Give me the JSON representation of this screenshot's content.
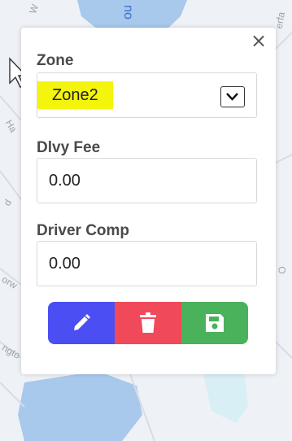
{
  "map": {
    "labels": [
      "W",
      "no",
      "erfa",
      "Ha",
      "d",
      "orw",
      "O",
      "ngto"
    ]
  },
  "form": {
    "close_glyph": "×",
    "zone": {
      "label": "Zone",
      "selected": "Zone2",
      "highlight_color": "#f4f50c"
    },
    "delivery_fee": {
      "label": "Dlvy Fee",
      "value": "0.00"
    },
    "driver_comp": {
      "label": "Driver Comp",
      "value": "0.00"
    },
    "actions": [
      {
        "name": "edit",
        "icon": "pencil-icon",
        "color": "#4b4ef2"
      },
      {
        "name": "delete",
        "icon": "trash-icon",
        "color": "#f04a5a"
      },
      {
        "name": "save",
        "icon": "floppy-disk-icon",
        "color": "#49b25a"
      }
    ]
  }
}
